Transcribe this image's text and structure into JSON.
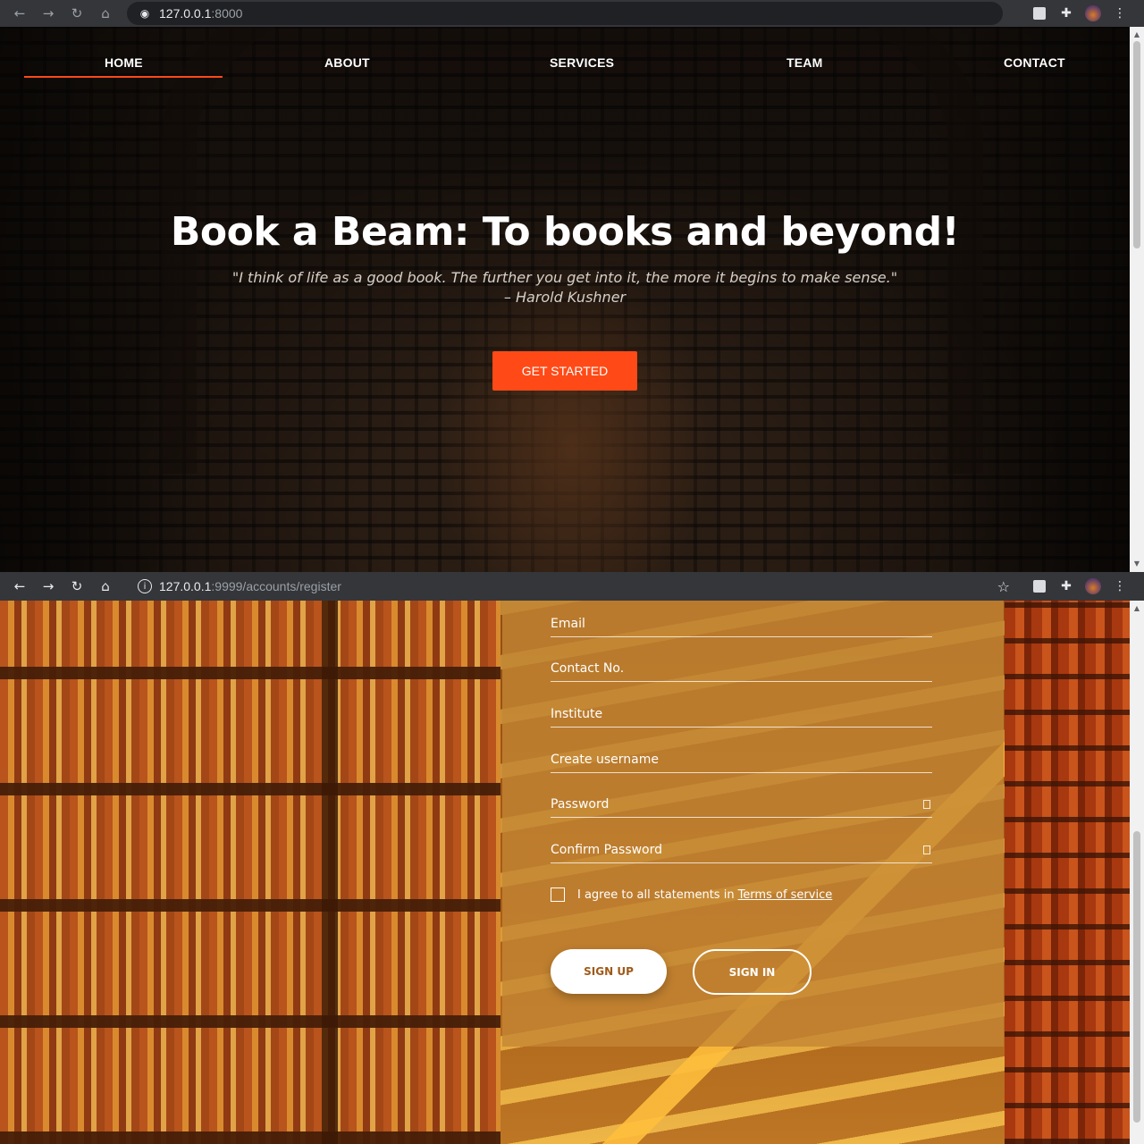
{
  "top_browser": {
    "url_host": "127.0.0.1",
    "url_rest": ":8000"
  },
  "top_nav": {
    "items": [
      {
        "label": "HOME",
        "active": true
      },
      {
        "label": "ABOUT"
      },
      {
        "label": "SERVICES"
      },
      {
        "label": "TEAM"
      },
      {
        "label": "CONTACT"
      }
    ]
  },
  "hero": {
    "title": "Book a Beam: To books and beyond!",
    "quote": "\"I think of life as a good book. The further you get into it, the more it begins to make sense.\"",
    "author": "– Harold Kushner",
    "cta_label": "GET STARTED"
  },
  "bottom_browser": {
    "url_host": "127.0.0.1",
    "url_rest": ":9999/accounts/register"
  },
  "register_form": {
    "fields": [
      {
        "label": "Email"
      },
      {
        "label": "Contact No."
      },
      {
        "label": "Institute"
      },
      {
        "label": "Create username"
      },
      {
        "label": "Password"
      },
      {
        "label": "Confirm Password"
      }
    ],
    "agree_text": "I agree to all statements in",
    "terms_link": "Terms of service",
    "signup_label": "SIGN UP",
    "signin_label": "SIGN IN"
  },
  "colors": {
    "accent": "#ff4a17",
    "form_overlay": "#c48634"
  },
  "icons": {
    "back": "arrow-left-icon",
    "forward": "arrow-right-icon",
    "reload": "reload-icon",
    "home": "home-icon",
    "site": "globe-icon",
    "info": "info-icon",
    "bookmark": "star-icon",
    "extensions": "puzzle-icon",
    "menu": "kebab-menu-icon",
    "password_toggle": "eye-icon"
  }
}
